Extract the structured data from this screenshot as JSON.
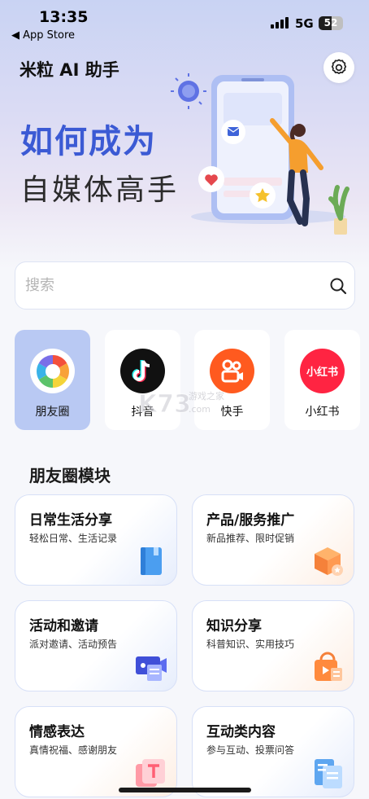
{
  "status_bar": {
    "time": "13:35",
    "back_label": "◀ App Store",
    "network": "5G",
    "battery_percent": "52",
    "battery_level": 0.52
  },
  "header": {
    "app_title": "米粒 AI 助手",
    "settings_icon": "gear-icon"
  },
  "hero": {
    "title": "如何成为",
    "subtitle": "自媒体高手"
  },
  "search": {
    "placeholder": "搜索",
    "icon": "search-icon"
  },
  "platforms": [
    {
      "label": "朋友圈",
      "icon": "moments-icon",
      "active": true
    },
    {
      "label": "抖音",
      "icon": "douyin-icon",
      "active": false
    },
    {
      "label": "快手",
      "icon": "kuaishou-icon",
      "active": false
    },
    {
      "label": "小红书",
      "icon": "xiaohongshu-icon",
      "logo_text": "小红书",
      "active": false
    }
  ],
  "watermark": {
    "brand": "K73",
    "tagline": "游戏之家",
    "domain": ".com"
  },
  "section": {
    "title": "朋友圈模块"
  },
  "cards": [
    {
      "title": "日常生活分享",
      "subtitle": "轻松日常、生活记录",
      "icon": "book-icon"
    },
    {
      "title": "产品/服务推广",
      "subtitle": "新品推荐、限时促销",
      "icon": "package-icon"
    },
    {
      "title": "活动和邀请",
      "subtitle": "派对邀请、活动预告",
      "icon": "invitation-icon"
    },
    {
      "title": "知识分享",
      "subtitle": "科普知识、实用技巧",
      "icon": "knowledge-bag-icon"
    },
    {
      "title": "情感表达",
      "subtitle": "真情祝福、感谢朋友",
      "icon": "text-card-icon"
    },
    {
      "title": "互动类内容",
      "subtitle": "参与互动、投票问答",
      "icon": "document-icon"
    }
  ],
  "colors": {
    "accent": "#3b5ad4",
    "active_tab": "#b9c9f3",
    "douyin": "#111111",
    "kuaishou": "#ff5a1f",
    "xiaohongshu": "#ff2442"
  }
}
